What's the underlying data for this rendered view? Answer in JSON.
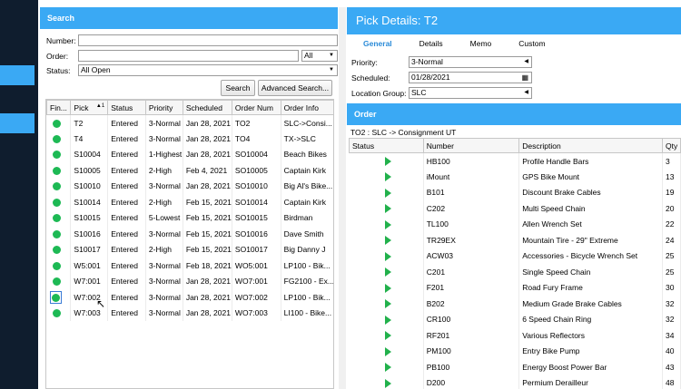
{
  "search": {
    "header": "Search",
    "number_label": "Number:",
    "number_value": "",
    "order_label": "Order:",
    "order_value": "",
    "order_scope": "All",
    "status_label": "Status:",
    "status_value": "All Open",
    "search_btn": "Search",
    "advanced_btn": "Advanced Search..."
  },
  "grid": {
    "columns": [
      "Fin...",
      "Pick",
      "Status",
      "Priority",
      "Scheduled",
      "Order Num",
      "Order Info"
    ],
    "sort_indicator": "1",
    "rows": [
      [
        "T2",
        "Entered",
        "3-Normal",
        "Jan 28, 2021",
        "TO2",
        "SLC->Consi..."
      ],
      [
        "T4",
        "Entered",
        "3-Normal",
        "Jan 28, 2021",
        "TO4",
        "TX->SLC"
      ],
      [
        "S10004",
        "Entered",
        "1-Highest",
        "Jan 28, 2021",
        "SO10004",
        "Beach Bikes"
      ],
      [
        "S10005",
        "Entered",
        "2-High",
        "Feb 4, 2021",
        "SO10005",
        "Captain Kirk"
      ],
      [
        "S10010",
        "Entered",
        "3-Normal",
        "Jan 28, 2021",
        "SO10010",
        "Big Al's Bike..."
      ],
      [
        "S10014",
        "Entered",
        "2-High",
        "Feb 15, 2021",
        "SO10014",
        "Captain Kirk"
      ],
      [
        "S10015",
        "Entered",
        "5-Lowest",
        "Feb 15, 2021",
        "SO10015",
        "Birdman"
      ],
      [
        "S10016",
        "Entered",
        "3-Normal",
        "Feb 15, 2021",
        "SO10016",
        "Dave Smith"
      ],
      [
        "S10017",
        "Entered",
        "2-High",
        "Feb 15, 2021",
        "SO10017",
        "Big Danny J"
      ],
      [
        "W5:001",
        "Entered",
        "3-Normal",
        "Feb 18, 2021",
        "WO5:001",
        "LP100 - Bik..."
      ],
      [
        "W7:001",
        "Entered",
        "3-Normal",
        "Jan 28, 2021",
        "WO7:001",
        "FG2100 - Ex..."
      ],
      [
        "W7:002",
        "Entered",
        "3-Normal",
        "Jan 28, 2021",
        "WO7:002",
        "LP100 - Bik..."
      ],
      [
        "W7:003",
        "Entered",
        "3-Normal",
        "Jan 28, 2021",
        "WO7:003",
        "LI100 - Bike..."
      ]
    ]
  },
  "details": {
    "title": "Pick Details: T2",
    "tabs": [
      "General",
      "Details",
      "Memo",
      "Custom"
    ],
    "priority_label": "Priority:",
    "priority_value": "3-Normal",
    "scheduled_label": "Scheduled:",
    "scheduled_value": "01/28/2021",
    "location_label": "Location Group:",
    "location_value": "SLC",
    "order_header": "Order",
    "order_sub": "TO2 : SLC -> Consignment UT",
    "order_columns": [
      "Status",
      "Number",
      "Description",
      "Qty"
    ],
    "order_rows": [
      [
        "HB100",
        "Profile Handle Bars",
        "3"
      ],
      [
        "iMount",
        "GPS Bike Mount",
        "13"
      ],
      [
        "B101",
        "Discount Brake Cables",
        "19"
      ],
      [
        "C202",
        "Multi Speed Chain",
        "20"
      ],
      [
        "TL100",
        "Allen Wrench Set",
        "22"
      ],
      [
        "TR29EX",
        "Mountain Tire - 29\" Extreme",
        "24"
      ],
      [
        "ACW03",
        "Accessories - Bicycle Wrench Set",
        "25"
      ],
      [
        "C201",
        "Single Speed Chain",
        "25"
      ],
      [
        "F201",
        "Road Fury Frame",
        "30"
      ],
      [
        "B202",
        "Medium Grade Brake Cables",
        "32"
      ],
      [
        "CR100",
        "6 Speed Chain Ring",
        "32"
      ],
      [
        "RF201",
        "Various Reflectors",
        "34"
      ],
      [
        "PM100",
        "Entry Bike Pump",
        "40"
      ],
      [
        "PB100",
        "Energy Boost Power Bar",
        "43"
      ],
      [
        "D200",
        "Permium Derailleur",
        "48"
      ]
    ]
  },
  "colors": {
    "accent": "#3aa9f4",
    "status_green": "#1db954",
    "rail": "#0f1d2e"
  }
}
